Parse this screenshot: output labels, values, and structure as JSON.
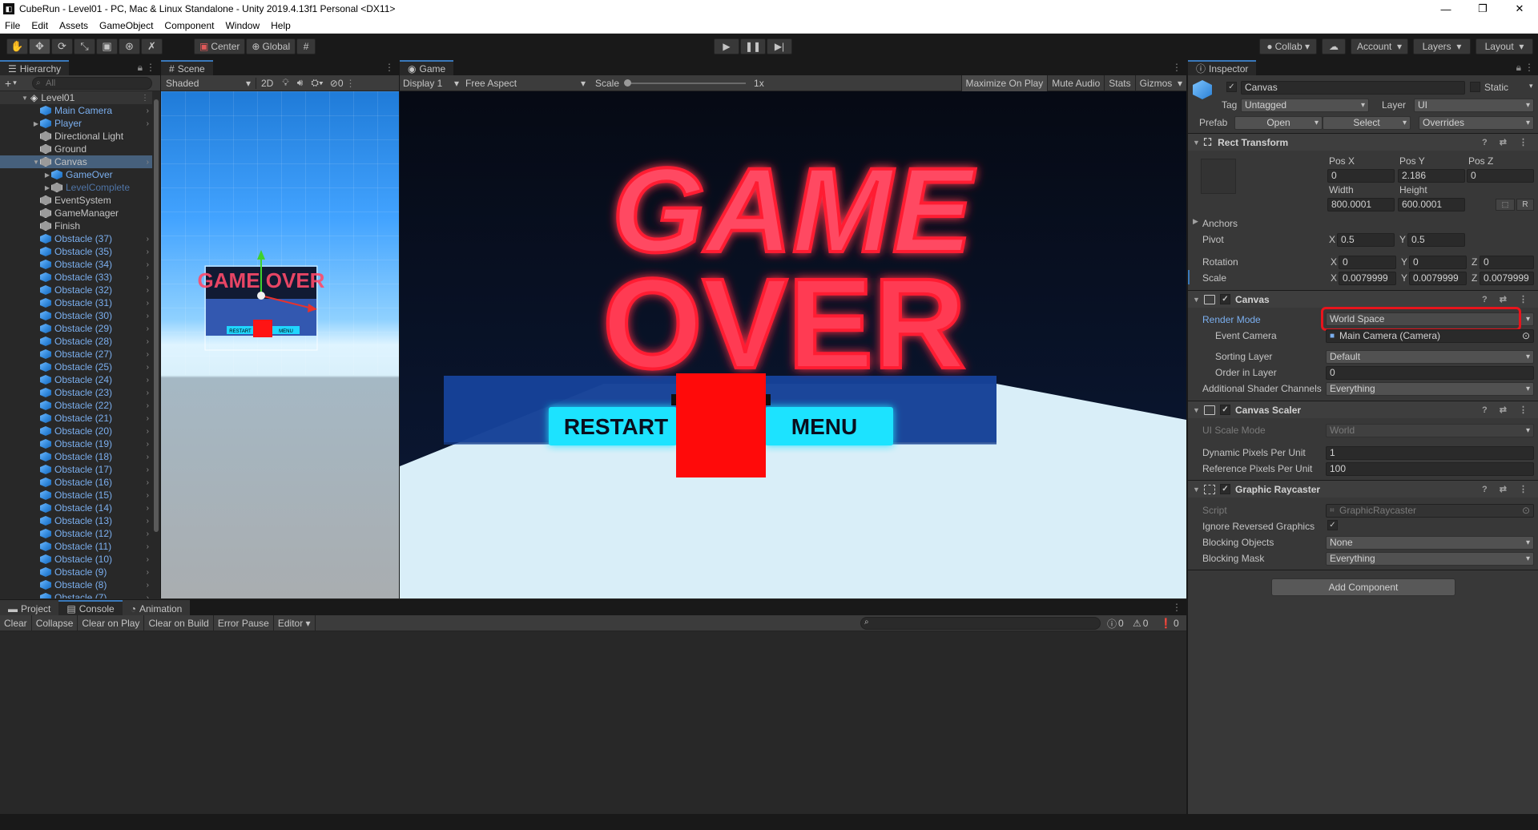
{
  "window": {
    "title": "CubeRun - Level01 - PC, Mac & Linux Standalone - Unity 2019.4.13f1 Personal <DX11>",
    "icon_glyph": "◧",
    "min_glyph": "—",
    "max_glyph": "❐",
    "close_glyph": "✕"
  },
  "menu": [
    "File",
    "Edit",
    "Assets",
    "GameObject",
    "Component",
    "Window",
    "Help"
  ],
  "toolbar": {
    "tools": [
      "✋",
      "✥",
      "⟳",
      "⤡",
      "▣",
      "⊛",
      "✗"
    ],
    "center_label": "Center",
    "global_label": "Global",
    "grid_glyph": "#",
    "play_glyph": "▶",
    "pause_glyph": "❚❚",
    "step_glyph": "▶|",
    "collab_label": "Collab",
    "cloud_glyph": "☁",
    "account_label": "Account",
    "layers_label": "Layers",
    "layout_label": "Layout"
  },
  "hierarchy": {
    "tab_label": "Hierarchy",
    "add_glyph": "+",
    "search_placeholder": "All",
    "scene_name": "Level01",
    "items": [
      {
        "label": "Main Camera",
        "indent": 1,
        "icon": "cube-blue",
        "style": "prefab",
        "arrow": "",
        "more": true
      },
      {
        "label": "Player",
        "indent": 1,
        "icon": "cube-blue",
        "style": "prefab",
        "arrow": "▶",
        "more": true
      },
      {
        "label": "Directional Light",
        "indent": 1,
        "icon": "cube-outline",
        "style": "",
        "arrow": "",
        "more": false
      },
      {
        "label": "Ground",
        "indent": 1,
        "icon": "cube-outline",
        "style": "",
        "arrow": "",
        "more": false
      },
      {
        "label": "Canvas",
        "indent": 1,
        "icon": "cube-outline",
        "style": "",
        "arrow": "▼",
        "more": true,
        "selected": true
      },
      {
        "label": "GameOver",
        "indent": 2,
        "icon": "cube-blue",
        "style": "prefab",
        "arrow": "▶",
        "more": false
      },
      {
        "label": "LevelComplete",
        "indent": 2,
        "icon": "cube-outline",
        "style": "faded",
        "arrow": "▶",
        "more": false
      },
      {
        "label": "EventSystem",
        "indent": 1,
        "icon": "cube-outline",
        "style": "",
        "arrow": "",
        "more": false
      },
      {
        "label": "GameManager",
        "indent": 1,
        "icon": "cube-outline",
        "style": "",
        "arrow": "",
        "more": false
      },
      {
        "label": "Finish",
        "indent": 1,
        "icon": "cube-outline",
        "style": "",
        "arrow": "",
        "more": false
      },
      {
        "label": "Obstacle (37)",
        "indent": 1,
        "icon": "cube-blue",
        "style": "prefab",
        "arrow": "",
        "more": true
      },
      {
        "label": "Obstacle (35)",
        "indent": 1,
        "icon": "cube-blue",
        "style": "prefab",
        "arrow": "",
        "more": true
      },
      {
        "label": "Obstacle (34)",
        "indent": 1,
        "icon": "cube-blue",
        "style": "prefab",
        "arrow": "",
        "more": true
      },
      {
        "label": "Obstacle (33)",
        "indent": 1,
        "icon": "cube-blue",
        "style": "prefab",
        "arrow": "",
        "more": true
      },
      {
        "label": "Obstacle (32)",
        "indent": 1,
        "icon": "cube-blue",
        "style": "prefab",
        "arrow": "",
        "more": true
      },
      {
        "label": "Obstacle (31)",
        "indent": 1,
        "icon": "cube-blue",
        "style": "prefab",
        "arrow": "",
        "more": true
      },
      {
        "label": "Obstacle (30)",
        "indent": 1,
        "icon": "cube-blue",
        "style": "prefab",
        "arrow": "",
        "more": true
      },
      {
        "label": "Obstacle (29)",
        "indent": 1,
        "icon": "cube-blue",
        "style": "prefab",
        "arrow": "",
        "more": true
      },
      {
        "label": "Obstacle (28)",
        "indent": 1,
        "icon": "cube-blue",
        "style": "prefab",
        "arrow": "",
        "more": true
      },
      {
        "label": "Obstacle (27)",
        "indent": 1,
        "icon": "cube-blue",
        "style": "prefab",
        "arrow": "",
        "more": true
      },
      {
        "label": "Obstacle (25)",
        "indent": 1,
        "icon": "cube-blue",
        "style": "prefab",
        "arrow": "",
        "more": true
      },
      {
        "label": "Obstacle (24)",
        "indent": 1,
        "icon": "cube-blue",
        "style": "prefab",
        "arrow": "",
        "more": true
      },
      {
        "label": "Obstacle (23)",
        "indent": 1,
        "icon": "cube-blue",
        "style": "prefab",
        "arrow": "",
        "more": true
      },
      {
        "label": "Obstacle (22)",
        "indent": 1,
        "icon": "cube-blue",
        "style": "prefab",
        "arrow": "",
        "more": true
      },
      {
        "label": "Obstacle (21)",
        "indent": 1,
        "icon": "cube-blue",
        "style": "prefab",
        "arrow": "",
        "more": true
      },
      {
        "label": "Obstacle (20)",
        "indent": 1,
        "icon": "cube-blue",
        "style": "prefab",
        "arrow": "",
        "more": true
      },
      {
        "label": "Obstacle (19)",
        "indent": 1,
        "icon": "cube-blue",
        "style": "prefab",
        "arrow": "",
        "more": true
      },
      {
        "label": "Obstacle (18)",
        "indent": 1,
        "icon": "cube-blue",
        "style": "prefab",
        "arrow": "",
        "more": true
      },
      {
        "label": "Obstacle (17)",
        "indent": 1,
        "icon": "cube-blue",
        "style": "prefab",
        "arrow": "",
        "more": true
      },
      {
        "label": "Obstacle (16)",
        "indent": 1,
        "icon": "cube-blue",
        "style": "prefab",
        "arrow": "",
        "more": true
      },
      {
        "label": "Obstacle (15)",
        "indent": 1,
        "icon": "cube-blue",
        "style": "prefab",
        "arrow": "",
        "more": true
      },
      {
        "label": "Obstacle (14)",
        "indent": 1,
        "icon": "cube-blue",
        "style": "prefab",
        "arrow": "",
        "more": true
      },
      {
        "label": "Obstacle (13)",
        "indent": 1,
        "icon": "cube-blue",
        "style": "prefab",
        "arrow": "",
        "more": true
      },
      {
        "label": "Obstacle (12)",
        "indent": 1,
        "icon": "cube-blue",
        "style": "prefab",
        "arrow": "",
        "more": true
      },
      {
        "label": "Obstacle (11)",
        "indent": 1,
        "icon": "cube-blue",
        "style": "prefab",
        "arrow": "",
        "more": true
      },
      {
        "label": "Obstacle (10)",
        "indent": 1,
        "icon": "cube-blue",
        "style": "prefab",
        "arrow": "",
        "more": true
      },
      {
        "label": "Obstacle (9)",
        "indent": 1,
        "icon": "cube-blue",
        "style": "prefab",
        "arrow": "",
        "more": true
      },
      {
        "label": "Obstacle (8)",
        "indent": 1,
        "icon": "cube-blue",
        "style": "prefab",
        "arrow": "",
        "more": true
      },
      {
        "label": "Obstacle (7)",
        "indent": 1,
        "icon": "cube-blue",
        "style": "prefab",
        "arrow": "",
        "more": true
      }
    ]
  },
  "scene": {
    "tab_label": "Scene",
    "shading": "Shaded",
    "mode_2d": "2D",
    "hidden_count": "0",
    "game_over_text": "GAME OVER",
    "restart_text": "RESTART",
    "menu_text": "MENU"
  },
  "game": {
    "tab_label": "Game",
    "display": "Display 1",
    "aspect": "Free Aspect",
    "scale_label": "Scale",
    "scale_value": "1x",
    "maximize_label": "Maximize On Play",
    "mute_label": "Mute Audio",
    "stats_label": "Stats",
    "gizmos_label": "Gizmos",
    "title_line1": "GAME",
    "title_line2": "OVER",
    "restart_label": "RESTART",
    "menu_label": "MENU"
  },
  "inspector": {
    "tab_label": "Inspector",
    "object_name": "Canvas",
    "static_label": "Static",
    "tag_label": "Tag",
    "tag_value": "Untagged",
    "layer_label": "Layer",
    "layer_value": "UI",
    "prefab_label": "Prefab",
    "open_label": "Open",
    "select_label": "Select",
    "overrides_label": "Overrides",
    "rect_transform": {
      "title": "Rect Transform",
      "posx_label": "Pos X",
      "posx": "0",
      "posy_label": "Pos Y",
      "posy": "2.186",
      "posz_label": "Pos Z",
      "posz": "0",
      "width_label": "Width",
      "width": "800.0001",
      "height_label": "Height",
      "height": "600.0001",
      "anchors_label": "Anchors",
      "pivot_label": "Pivot",
      "pivot_x": "0.5",
      "pivot_y": "0.5",
      "rotation_label": "Rotation",
      "rot_x": "0",
      "rot_y": "0",
      "rot_z": "0",
      "scale_label": "Scale",
      "scale_x": "0.0079999",
      "scale_y": "0.0079999",
      "scale_z": "0.0079999",
      "r_button": "R"
    },
    "canvas": {
      "title": "Canvas",
      "render_mode_label": "Render Mode",
      "render_mode_value": "World Space",
      "event_camera_label": "Event Camera",
      "event_camera_value": "Main Camera (Camera)",
      "sorting_layer_label": "Sorting Layer",
      "sorting_layer_value": "Default",
      "order_label": "Order in Layer",
      "order_value": "0",
      "shader_channels_label": "Additional Shader Channels",
      "shader_channels_value": "Everything"
    },
    "canvas_scaler": {
      "title": "Canvas Scaler",
      "ui_scale_label": "UI Scale Mode",
      "ui_scale_value": "World",
      "dpu_label": "Dynamic Pixels Per Unit",
      "dpu_value": "1",
      "rppu_label": "Reference Pixels Per Unit",
      "rppu_value": "100"
    },
    "raycaster": {
      "title": "Graphic Raycaster",
      "script_label": "Script",
      "script_value": "GraphicRaycaster",
      "ignore_label": "Ignore Reversed Graphics",
      "blocking_objects_label": "Blocking Objects",
      "blocking_objects_value": "None",
      "blocking_mask_label": "Blocking Mask",
      "blocking_mask_value": "Everything"
    },
    "add_component_label": "Add Component",
    "header_icons": "? ⇄ ⋮",
    "check_glyph": "✓"
  },
  "bottom": {
    "tabs": [
      "Project",
      "Console",
      "Animation"
    ],
    "clear_label": "Clear",
    "collapse_label": "Collapse",
    "clear_on_play_label": "Clear on Play",
    "clear_on_build_label": "Clear on Build",
    "error_pause_label": "Error Pause",
    "editor_label": "Editor",
    "log_count": "0",
    "warn_count": "0",
    "error_count": "0"
  },
  "colors": {
    "accent_blue": "#3a79bb",
    "neon_red": "#ff2a3a",
    "neon_cyan": "#1ee3ff",
    "highlight_red": "#e8141c"
  }
}
